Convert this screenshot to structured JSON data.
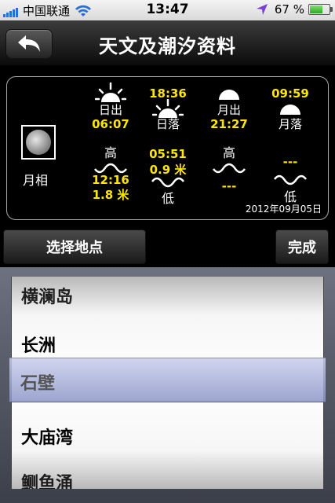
{
  "status_bar": {
    "carrier": "中国联通",
    "time": "13:47",
    "battery_text": "67 %",
    "battery_level": 0.67
  },
  "nav": {
    "title": "天文及潮汐资料"
  },
  "sun_moon": {
    "sunrise_label": "日出",
    "sunrise_time": "06:07",
    "sunset_time": "18:36",
    "sunset_label": "日落",
    "moonrise_label": "月出",
    "moonrise_time": "21:27",
    "moonset_time": "09:59",
    "moonset_label": "月落",
    "moon_phase_label": "月相"
  },
  "tides": {
    "high1_label": "高",
    "high1_time": "12:16",
    "high1_height": "1.8 米",
    "low1_time": "05:51",
    "low1_height": "0.9 米",
    "low1_label": "低",
    "high2_label": "高",
    "high2_time": "---",
    "low2_time": "---",
    "low2_label": "低"
  },
  "date": "2012年09月05日",
  "toolbar": {
    "select_location": "选择地点",
    "done": "完成"
  },
  "picker": {
    "items": [
      "横澜岛",
      "长洲",
      "石壁",
      "大庙湾",
      "鲗鱼涌"
    ],
    "selected": "石壁"
  }
}
